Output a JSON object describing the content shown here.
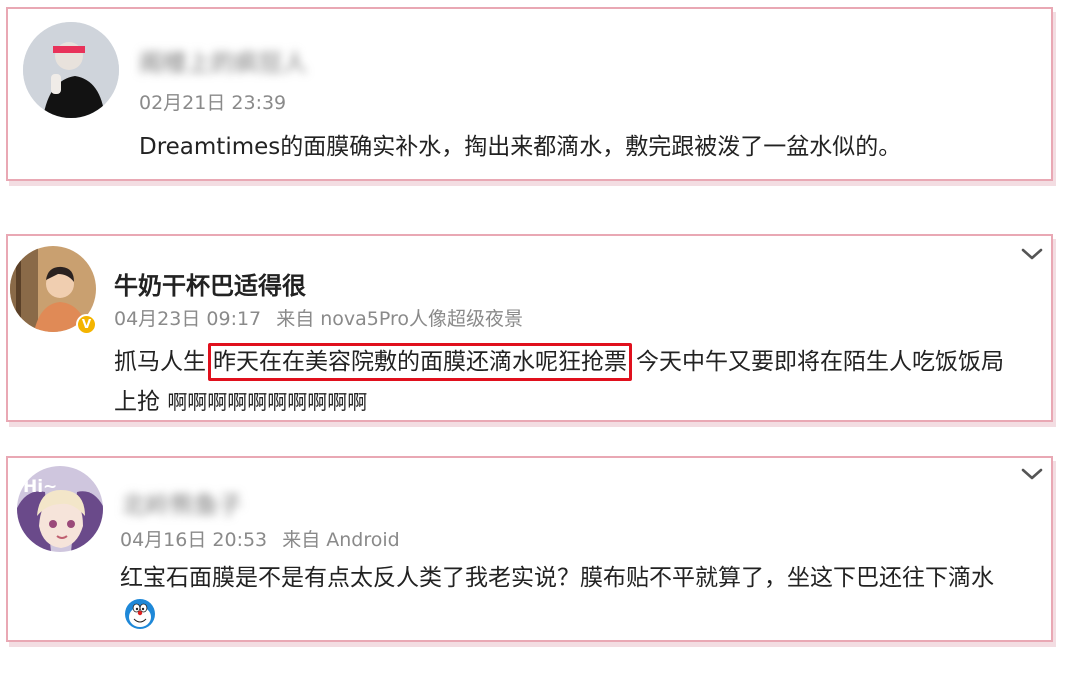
{
  "comments": [
    {
      "username": "阁楼上的疯狂人",
      "date": "02月21日 23:39",
      "source": "",
      "text": "Dreamtimes的面膜确实补水，掏出来都滴水，敷完跟被泼了一盆水似的。"
    },
    {
      "username": "牛奶干杯巴适得很",
      "date": "04月23日 09:17",
      "source": "来自 nova5Pro人像超级夜景",
      "text_before": "抓马人生",
      "text_highlight": "昨天在在美容院敷的面膜还滴水呢狂抢票",
      "text_after": "今天中午又要即将在陌生人吃饭饭局",
      "text_line2": "上抢",
      "text_line2_tail": "啊啊啊啊啊啊啊啊啊啊",
      "verified": "V"
    },
    {
      "username": "北岭熊鱼子",
      "date": "04月16日 20:53",
      "source": "来自 Android",
      "text": "红宝石面膜是不是有点太反人类了我老实说？膜布贴不平就算了，坐这下巴还往下滴水",
      "avatar_text": "Hi~"
    }
  ],
  "colors": {
    "card_border": "#e9a8b4",
    "highlight_box": "#e0101d",
    "meta_text": "#8a8a8a",
    "verified_badge": "#f4b400"
  },
  "icons": {
    "menu": "chevron-down-icon",
    "emoji": "doraemon-emoji-icon"
  }
}
